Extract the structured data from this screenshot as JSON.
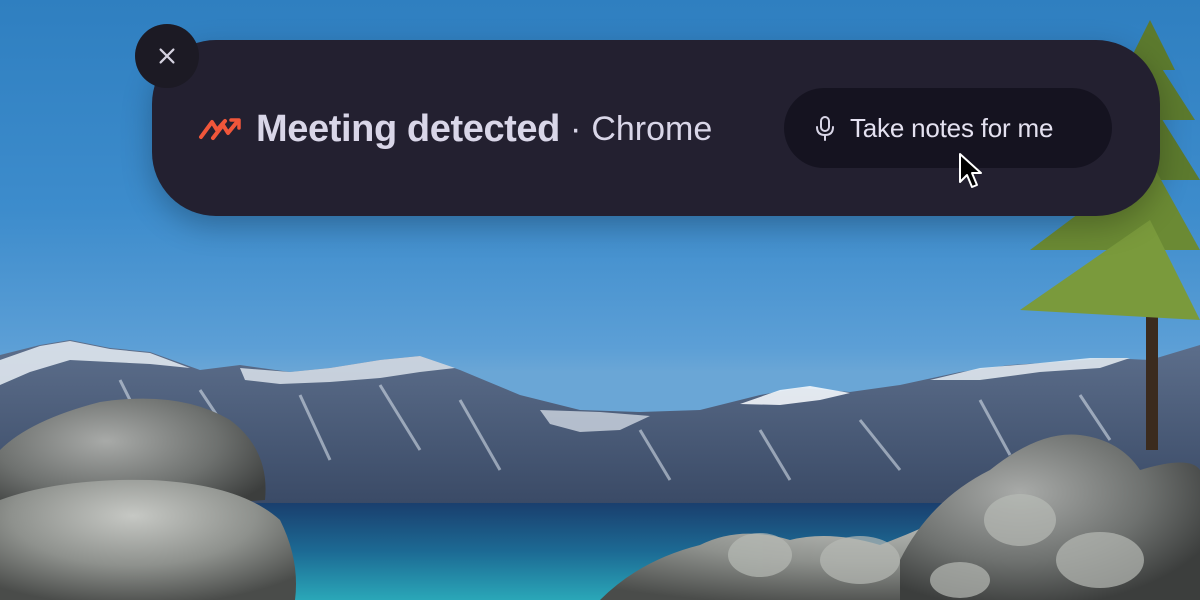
{
  "notification": {
    "title": "Meeting detected",
    "separator": "·",
    "app_name": "Chrome",
    "action_label": "Take notes for me",
    "close_icon": "close-icon",
    "brand_icon": "brand-logo-icon",
    "action_icon": "microphone-icon"
  },
  "colors": {
    "panel_bg": "#232030",
    "button_bg": "#151320",
    "brand_accent": "#f0563a",
    "text": "#d9d6e8"
  },
  "wallpaper": {
    "subject": "lake with snowy mountains, rocks and pine tree"
  }
}
